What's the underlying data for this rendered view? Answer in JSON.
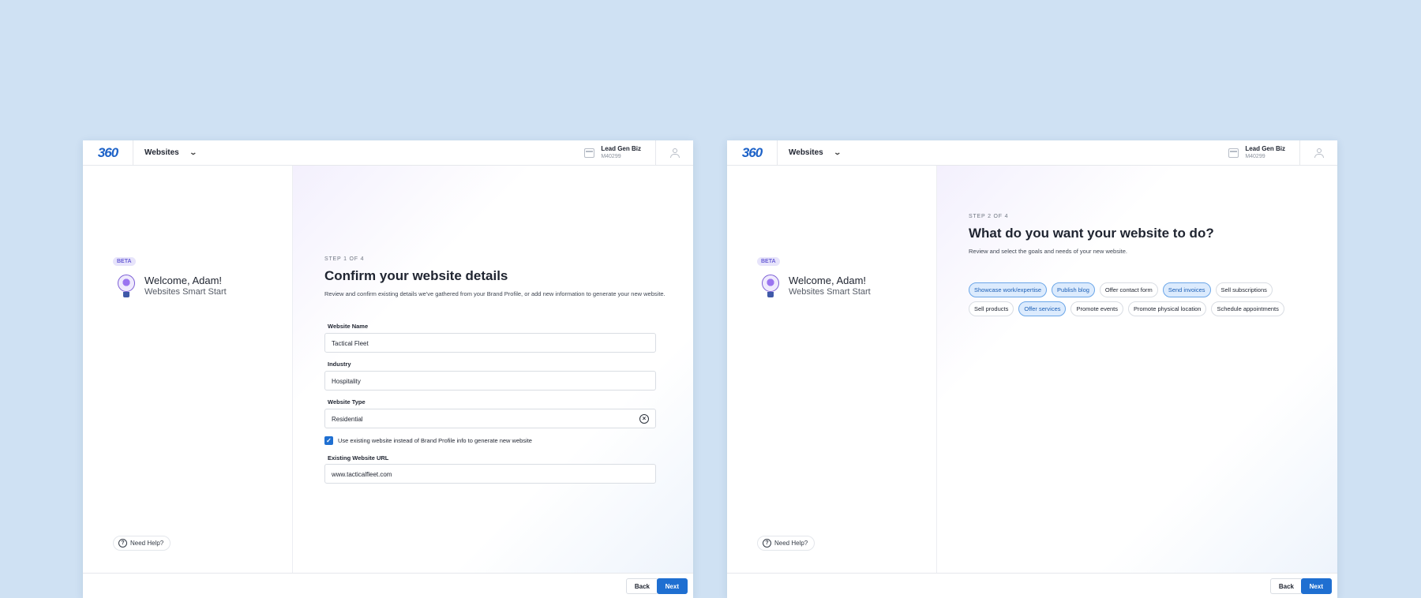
{
  "header": {
    "logo": "360",
    "app_name": "Websites",
    "business_name": "Lead Gen Biz",
    "business_id": "M40299"
  },
  "sidebar": {
    "badge": "BETA",
    "welcome_title": "Welcome, Adam!",
    "welcome_subtitle": "Websites Smart Start",
    "help_label": "Need Help?"
  },
  "step1": {
    "step_label": "STEP 1 OF 4",
    "title": "Confirm your website details",
    "description": "Review and confirm existing details we've gathered from your Brand Profile, or add new information to generate your new website.",
    "fields": {
      "website_name_label": "Website Name",
      "website_name_value": "Tactical Fleet",
      "industry_label": "Industry",
      "industry_value": "Hospitality",
      "website_type_label": "Website Type",
      "website_type_value": "Residential",
      "use_existing_label": "Use existing website instead of Brand Profile info to generate new website",
      "existing_url_label": "Existing Website URL",
      "existing_url_value": "www.tacticalfleet.com"
    }
  },
  "step2": {
    "step_label": "STEP 2 OF 4",
    "title": "What do you want your website to do?",
    "description": "Review and select the goals and needs of your new website.",
    "chips_row1": [
      {
        "label": "Showcase work/expertise",
        "selected": true
      },
      {
        "label": "Publish blog",
        "selected": true
      },
      {
        "label": "Offer contact form",
        "selected": false
      },
      {
        "label": "Send invoices",
        "selected": true
      },
      {
        "label": "Sell subscriptions",
        "selected": false
      }
    ],
    "chips_row2": [
      {
        "label": "Sell products",
        "selected": false
      },
      {
        "label": "Offer services",
        "selected": true
      },
      {
        "label": "Promote events",
        "selected": false
      },
      {
        "label": "Promote physical location",
        "selected": false
      },
      {
        "label": "Schedule appointments",
        "selected": false
      }
    ]
  },
  "footer": {
    "back_label": "Back",
    "next_label": "Next"
  },
  "colors": {
    "background": "#cfe1f3",
    "accent": "#1f6fd1",
    "chip_selected_bg": "#dcebfd"
  }
}
